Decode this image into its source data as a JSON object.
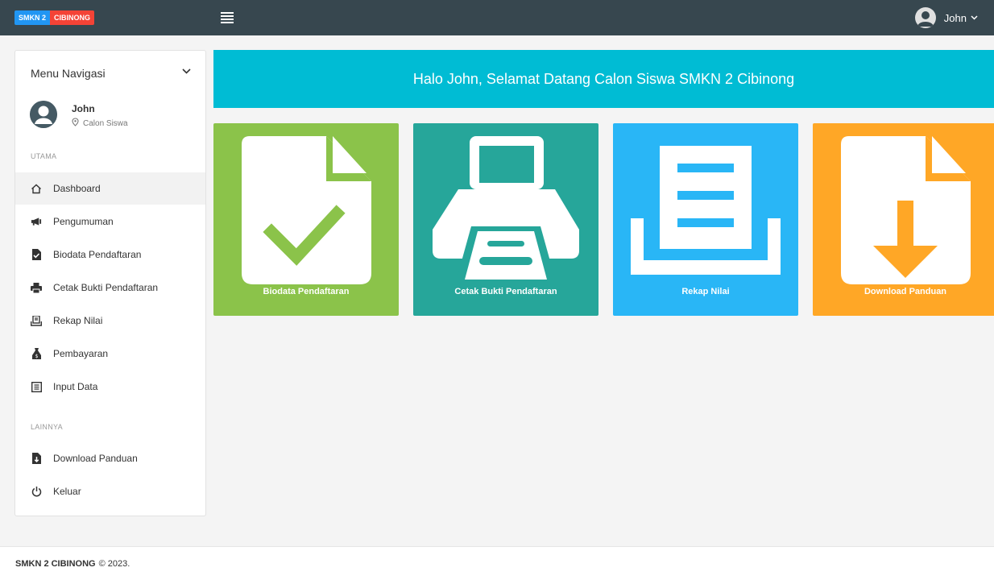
{
  "brand": {
    "part1": "SMKN 2",
    "part2": "CIBINONG",
    "color1": "#2196f3",
    "color2": "#f44336"
  },
  "topbar": {
    "user_name": "John",
    "bg": "#37474f"
  },
  "sidebar": {
    "title": "Menu Navigasi",
    "profile": {
      "name": "John",
      "role": "Calon Siswa"
    },
    "section_main": "UTAMA",
    "section_other": "LAINNYA",
    "items": [
      {
        "label": "Dashboard",
        "icon": "home-icon"
      },
      {
        "label": "Pengumuman",
        "icon": "megaphone-icon"
      },
      {
        "label": "Biodata Pendaftaran",
        "icon": "file-check-icon"
      },
      {
        "label": "Cetak Bukti Pendaftaran",
        "icon": "printer-icon"
      },
      {
        "label": "Rekap Nilai",
        "icon": "receipt-icon"
      },
      {
        "label": "Pembayaran",
        "icon": "money-bag-icon"
      },
      {
        "label": "Input Data",
        "icon": "list-box-icon"
      },
      {
        "label": "Download Panduan",
        "icon": "file-download-icon"
      },
      {
        "label": "Keluar",
        "icon": "power-icon"
      }
    ]
  },
  "welcome": {
    "text": "Halo John, Selamat Datang Calon Siswa SMKN 2 Cibinong",
    "bg": "#00bcd4"
  },
  "tiles": [
    {
      "label": "Biodata Pendaftaran",
      "color": "#8bc34a",
      "icon": "file-check-icon"
    },
    {
      "label": "Cetak Bukti Pendaftaran",
      "color": "#26a69a",
      "icon": "printer-icon"
    },
    {
      "label": "Rekap Nilai",
      "color": "#29b6f6",
      "icon": "receipt-icon"
    },
    {
      "label": "Download Panduan",
      "color": "#ffa726",
      "icon": "file-download-icon"
    }
  ],
  "footer": {
    "brand": "SMKN 2 CIBINONG",
    "copyright": "© 2023."
  }
}
